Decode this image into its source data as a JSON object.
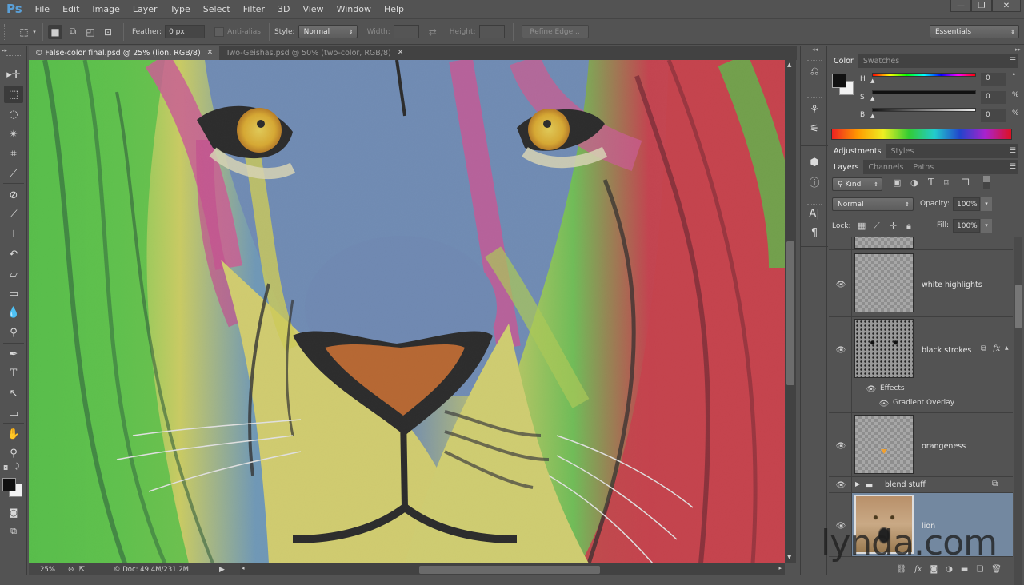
{
  "app": {
    "logo": "Ps"
  },
  "menu": [
    "File",
    "Edit",
    "Image",
    "Layer",
    "Type",
    "Select",
    "Filter",
    "3D",
    "View",
    "Window",
    "Help"
  ],
  "window_controls": {
    "minimize": "—",
    "restore": "❐",
    "close": "✕"
  },
  "options": {
    "feather_label": "Feather:",
    "feather_value": "0 px",
    "antialias_label": "Anti-alias",
    "style_label": "Style:",
    "style_value": "Normal",
    "width_label": "Width:",
    "height_label": "Height:",
    "refine_edge": "Refine Edge...",
    "workspace": "Essentials"
  },
  "doc_tabs": [
    {
      "label": "© False-color final.psd @ 25% (lion, RGB/8)",
      "active": true
    },
    {
      "label": "Two-Geishas.psd @ 50% (two-color, RGB/8)",
      "active": false
    }
  ],
  "tools": [
    "move",
    "rectangular-marquee",
    "lasso",
    "magic-wand",
    "crop",
    "eyedropper",
    "spot-healing",
    "brush",
    "clone-stamp",
    "history-brush",
    "eraser",
    "gradient",
    "blur",
    "dodge",
    "pen",
    "type",
    "path-selection",
    "rectangle",
    "hand",
    "zoom"
  ],
  "status": {
    "zoom": "25%",
    "doc": "© Doc: 49.4M/231.2M"
  },
  "color_panel": {
    "tabs": [
      "Color",
      "Swatches"
    ],
    "sliders": [
      {
        "label": "H",
        "value": "0",
        "unit": "°"
      },
      {
        "label": "S",
        "value": "0",
        "unit": "%"
      },
      {
        "label": "B",
        "value": "0",
        "unit": "%"
      }
    ],
    "foreground": "#111111",
    "background": "#f2f2f2"
  },
  "adjustments_panel": {
    "tabs": [
      "Adjustments",
      "Styles"
    ]
  },
  "layers_panel": {
    "tabs": [
      "Layers",
      "Channels",
      "Paths"
    ],
    "filter_kind": "Kind",
    "blend_mode": "Normal",
    "opacity_label": "Opacity:",
    "opacity_value": "100%",
    "lock_label": "Lock:",
    "fill_label": "Fill:",
    "fill_value": "100%",
    "layers": [
      {
        "name": "white highlights",
        "visible": true
      },
      {
        "name": "black strokes",
        "visible": true,
        "has_fx": true,
        "effects_label": "Effects",
        "effects": [
          "Gradient Overlay"
        ]
      },
      {
        "name": "orangeness",
        "visible": true
      },
      {
        "name": "blend stuff",
        "visible": true,
        "type": "group"
      },
      {
        "name": "lion",
        "visible": true,
        "selected": true
      }
    ]
  },
  "watermark": "lynda.com"
}
